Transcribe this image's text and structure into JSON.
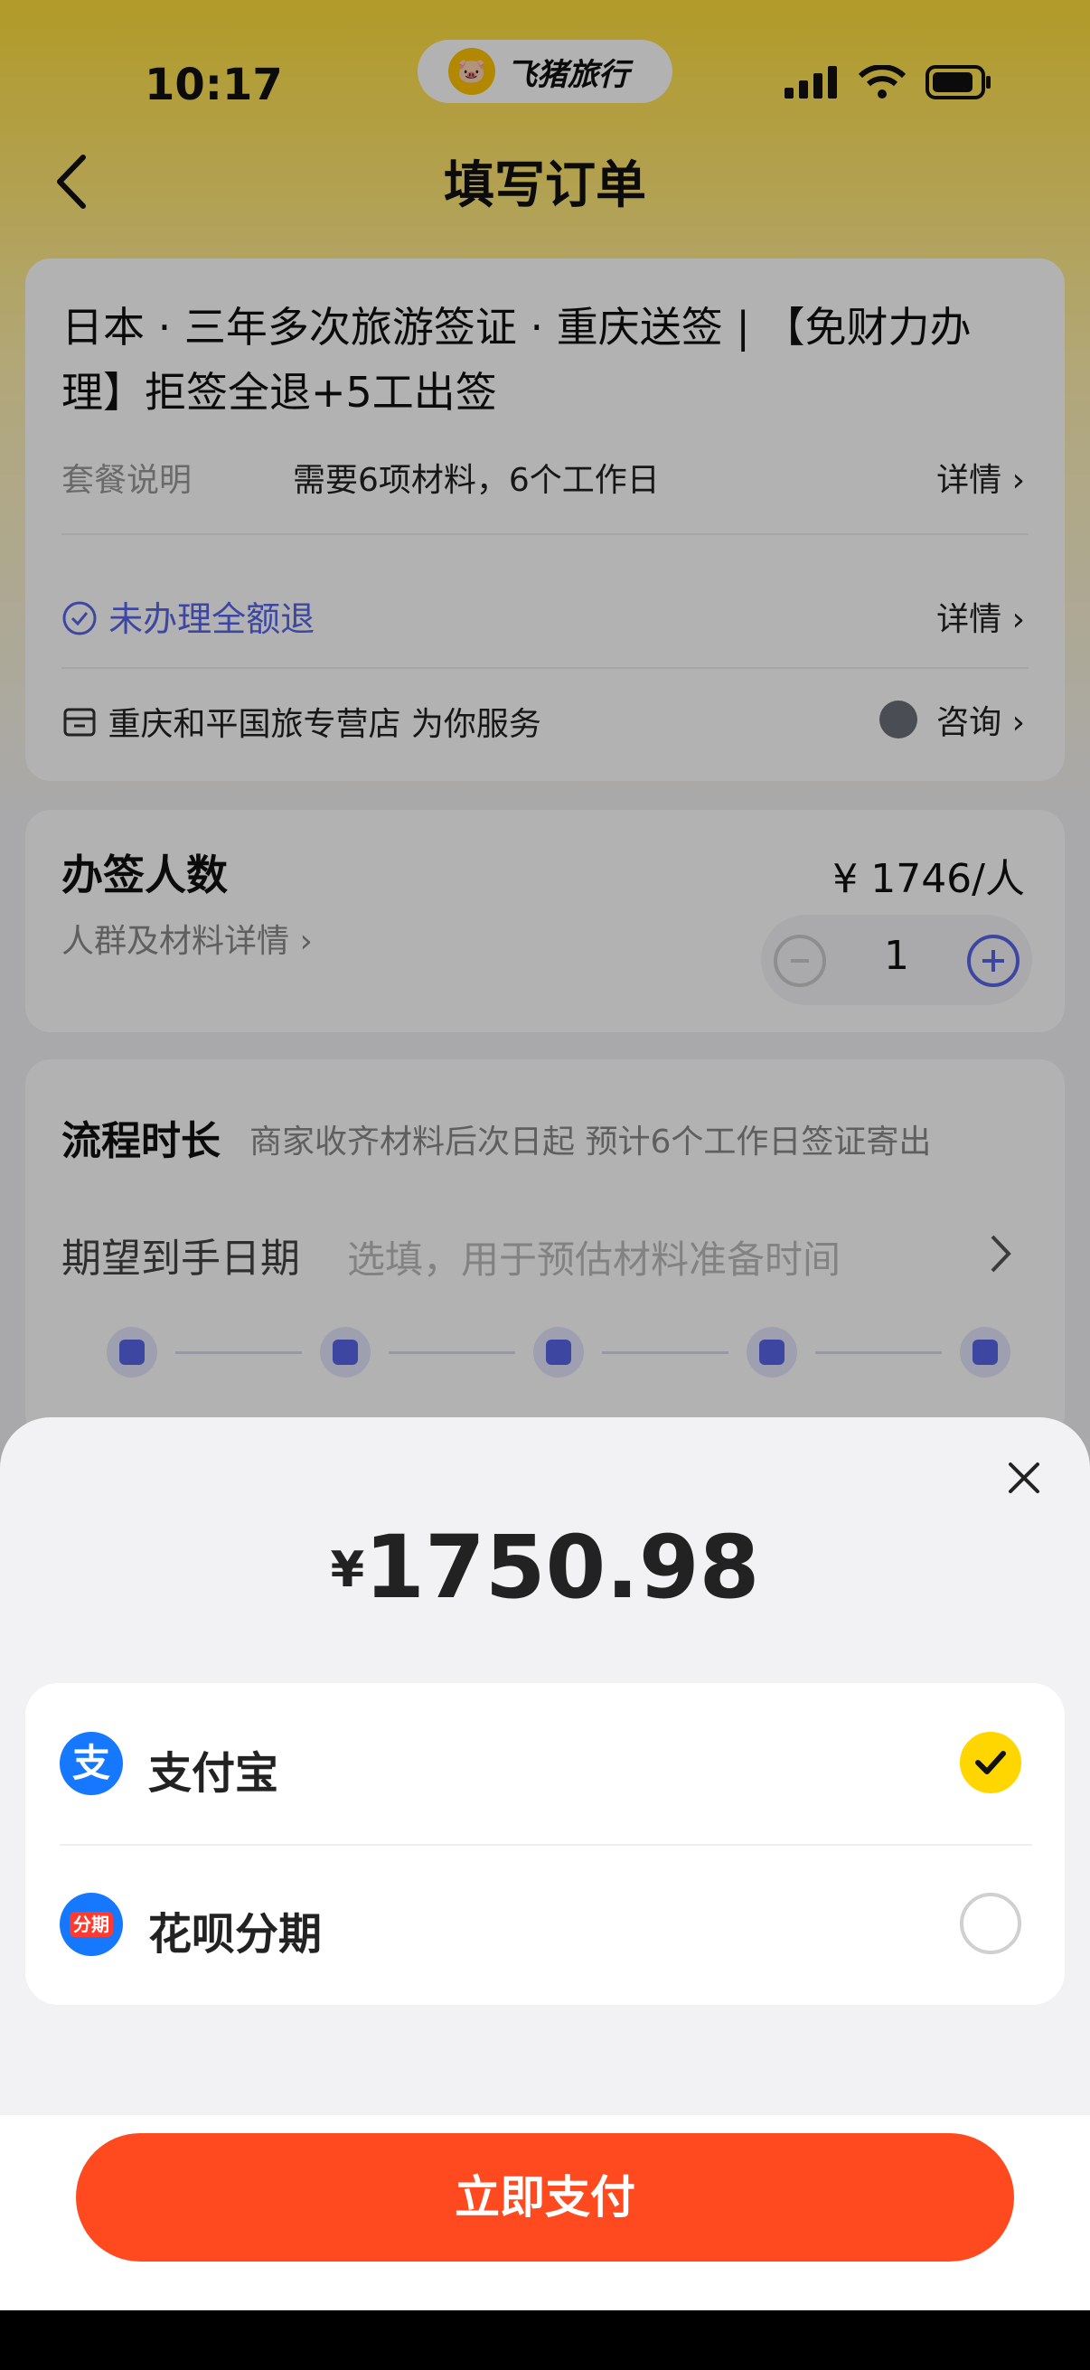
{
  "status_bar": {
    "time": "10:17",
    "app_name": "飞猪旅行",
    "app_logo_icon": "pig-logo-icon"
  },
  "nav": {
    "title": "填写订单",
    "back_icon": "chevron-left-icon"
  },
  "product": {
    "title": "日本 · 三年多次旅游签证 · 重庆送签 | 【免财力办理】拒签全退+5工出签",
    "package_label": "套餐说明",
    "package_text": "需要6项材料，6个工作日",
    "details_label": "详情",
    "refund_text": "未办理全额退",
    "refund_details_label": "详情",
    "shop_text": "重庆和平国旅专营店 为你服务",
    "consult_label": "咨询"
  },
  "people": {
    "title": "办签人数",
    "sub_link": "人群及材料详情",
    "price": "¥ 1746/人",
    "quantity": "1"
  },
  "flow": {
    "title": "流程时长",
    "subtitle": "商家收齐材料后次日起 预计6个工作日签证寄出",
    "expect_label": "期望到手日期",
    "expect_placeholder": "选填，用于预估材料准备时间"
  },
  "payment_sheet": {
    "currency": "¥",
    "amount": "1750.98",
    "methods": [
      {
        "label": "支付宝",
        "icon": "alipay-icon",
        "icon_text": "支",
        "selected": true
      },
      {
        "label": "花呗分期",
        "icon": "huabei-icon",
        "icon_text": "分期",
        "selected": false
      }
    ],
    "pay_button": "立即支付"
  },
  "colors": {
    "accent_yellow": "#ffd600",
    "pay_orange": "#ff4a1f",
    "link_purple": "#5866e8"
  }
}
